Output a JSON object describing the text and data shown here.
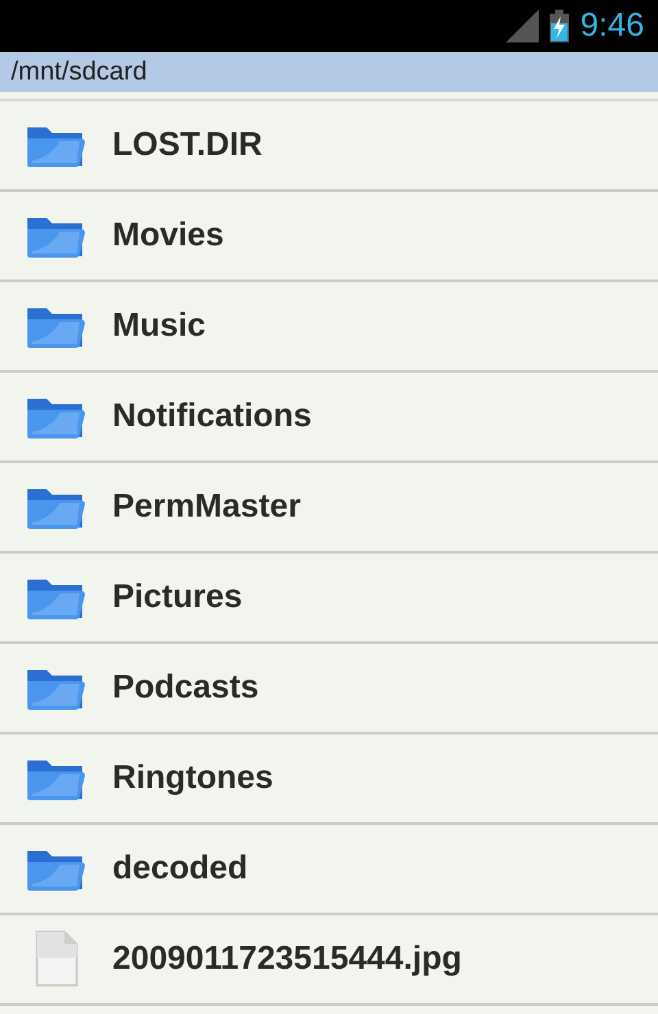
{
  "status_bar": {
    "time": "9:46"
  },
  "path": "/mnt/sdcard",
  "items": [
    {
      "name": "LOST.DIR",
      "kind": "folder"
    },
    {
      "name": "Movies",
      "kind": "folder"
    },
    {
      "name": "Music",
      "kind": "folder"
    },
    {
      "name": "Notifications",
      "kind": "folder"
    },
    {
      "name": "PermMaster",
      "kind": "folder"
    },
    {
      "name": "Pictures",
      "kind": "folder"
    },
    {
      "name": "Podcasts",
      "kind": "folder"
    },
    {
      "name": "Ringtones",
      "kind": "folder"
    },
    {
      "name": "decoded",
      "kind": "folder"
    },
    {
      "name": "2009011723515444.jpg",
      "kind": "file"
    }
  ]
}
